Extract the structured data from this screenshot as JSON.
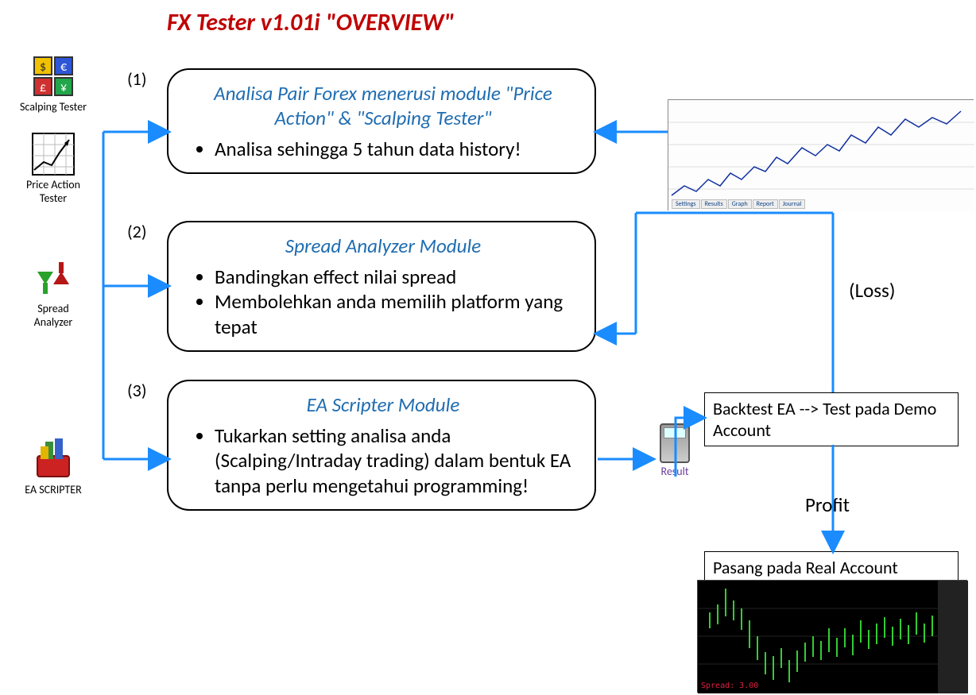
{
  "title": "FX Tester v1.01i \"OVERVIEW\"",
  "icons": {
    "scalping": "Scalping Tester",
    "priceaction": "Price Action Tester",
    "spread": "Spread Analyzer",
    "eascripter": "EA SCRIPTER"
  },
  "numbers": {
    "n1": "(1)",
    "n2": "(2)",
    "n3": "(3)"
  },
  "modules": {
    "m1_title": "Analisa Pair Forex menerusi module \"Price Action\" & \"Scalping Tester\"",
    "m1_b1": "Analisa sehingga 5 tahun data history!",
    "m2_title": "Spread Analyzer Module",
    "m2_b1": "Bandingkan effect nilai spread",
    "m2_b2": "Membolehkan anda memilih platform yang tepat",
    "m3_title": "EA Scripter Module",
    "m3_b1": "Tukarkan setting analisa anda (Scalping/Intraday trading) dalam bentuk EA tanpa perlu mengetahui programming!"
  },
  "result_label": "Result",
  "loss_label": "(Loss)",
  "profit_label": "Profit",
  "backtest_box": "Backtest EA --> Test pada Demo Account",
  "real_box": "Pasang pada Real Account",
  "spread_text": "Spread: 3.00",
  "chart_tabs": {
    "t1": "Settings",
    "t2": "Results",
    "t3": "Graph",
    "t4": "Report",
    "t5": "Journal"
  }
}
